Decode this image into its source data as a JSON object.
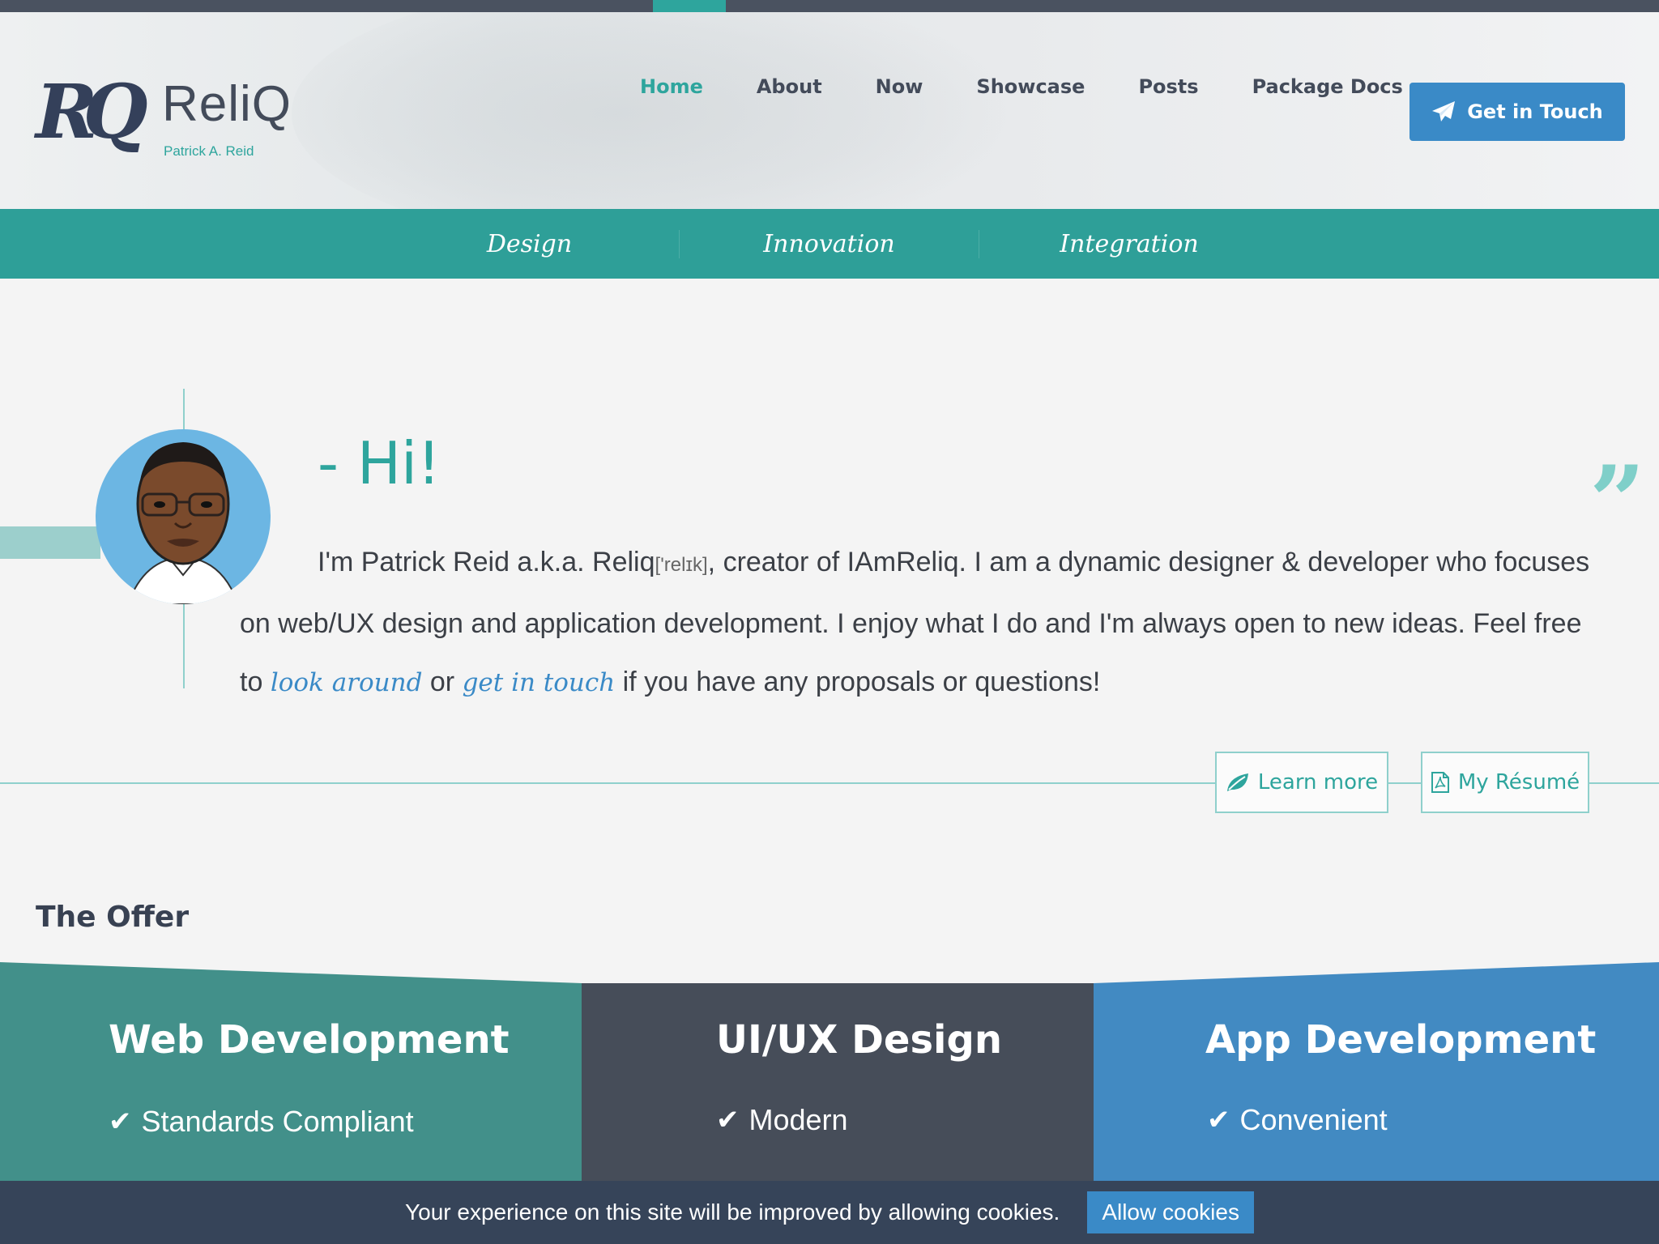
{
  "brand": {
    "mark": "RQ",
    "name": "ReliQ",
    "subtitle": "Patrick A. Reid"
  },
  "nav": {
    "items": [
      {
        "label": "Home",
        "active": true
      },
      {
        "label": "About"
      },
      {
        "label": "Now"
      },
      {
        "label": "Showcase"
      },
      {
        "label": "Posts"
      },
      {
        "label": "Package Docs"
      }
    ],
    "cta": {
      "label": "Get in Touch",
      "icon": "paper-plane-icon"
    }
  },
  "tagline": [
    "Design",
    "Innovation",
    "Integration"
  ],
  "intro": {
    "greeting": "- Hi!",
    "bio_start": "I'm Patrick Reid a.k.a. Reliq",
    "phonetic": "['relɪk]",
    "bio_mid": ", creator of IAmReliq. I am a dynamic designer & developer who focuses on web/UX design and application development. I enjoy what I do and I'm always open to new ideas. Feel free to ",
    "link_look": "look around",
    "bio_or": " or ",
    "link_touch": "get in touch",
    "bio_end": " if you have any proposals or questions!",
    "quote_glyph": "”"
  },
  "actions": {
    "learn_more": "Learn more",
    "resume": "My Résumé"
  },
  "offer": {
    "title": "The Offer",
    "panels": [
      {
        "title": "Web Development",
        "feature": "Standards Compliant",
        "color": "#42908a"
      },
      {
        "title": "UI/UX Design",
        "feature": "Modern",
        "color": "#464d59"
      },
      {
        "title": "App Development",
        "feature": "Convenient",
        "color": "#428ac2"
      }
    ]
  },
  "cookie": {
    "text": "Your experience on this site will be improved by allowing cookies.",
    "button": "Allow cookies"
  },
  "colors": {
    "teal": "#2ea59d",
    "blue": "#3a8ac7",
    "dark": "#364459"
  }
}
